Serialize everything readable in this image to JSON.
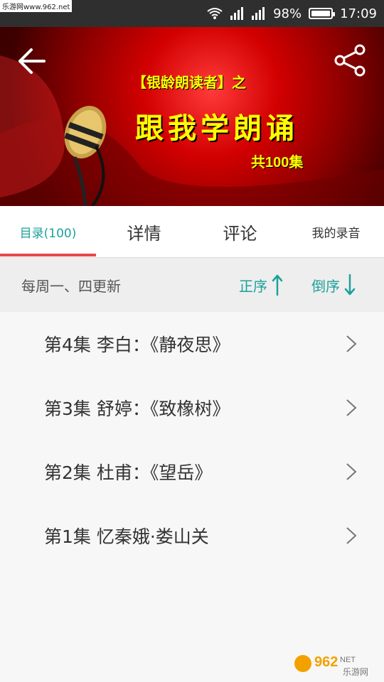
{
  "status": {
    "watermark": "乐游网www.962.net",
    "battery": "98%",
    "battery_level": 0.98,
    "time": "17:09"
  },
  "hero": {
    "subtitle": "【银龄朗读者】之",
    "title": "跟我学朗诵",
    "count": "共100集",
    "colors": {
      "text": "#ffff00",
      "bg": "#c00000"
    }
  },
  "tabs": [
    {
      "label": "目录(100)",
      "active": true
    },
    {
      "label": "详情",
      "active": false
    },
    {
      "label": "评论",
      "active": false
    },
    {
      "label": "我的录音",
      "active": false
    }
  ],
  "sort": {
    "note": "每周一、四更新",
    "asc": "正序",
    "desc": "倒序",
    "accent": "#1ba19a"
  },
  "episodes": [
    {
      "label": "第4集 李白：《静夜思》"
    },
    {
      "label": "第3集 舒婷：《致橡树》"
    },
    {
      "label": "第2集 杜甫：《望岳》"
    },
    {
      "label": "第1集 忆秦娥·娄山关"
    }
  ],
  "watermark_bottom": {
    "brand": "962",
    "suffix": "NET",
    "cn": "乐游网"
  }
}
